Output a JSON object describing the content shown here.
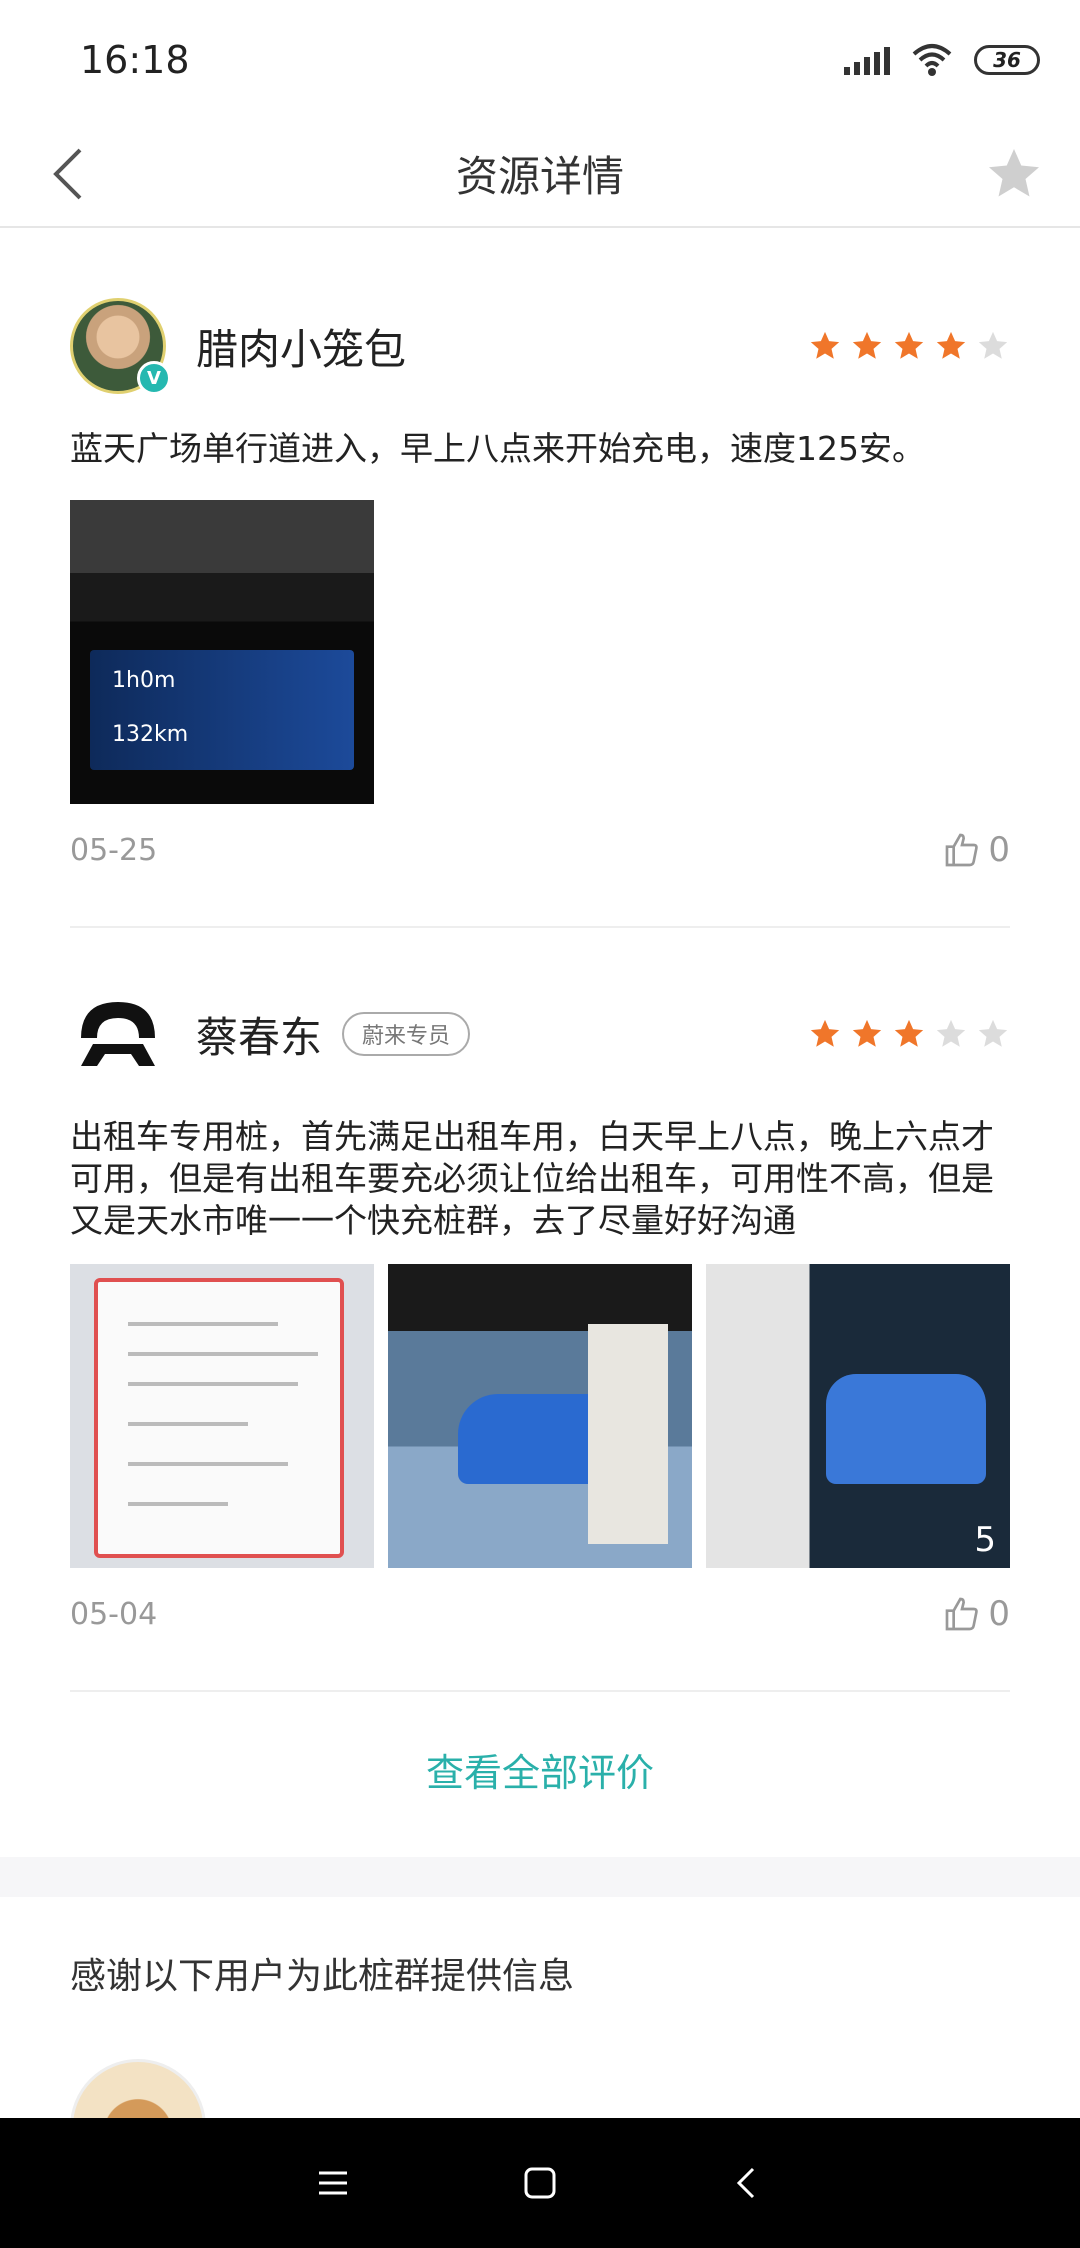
{
  "status_bar": {
    "time": "16:18",
    "battery": "36"
  },
  "header": {
    "title": "资源详情"
  },
  "reviews": [
    {
      "user": "腊肉小笼包",
      "verified_badge": "V",
      "rating": 4,
      "rating_max": 5,
      "text": "蓝天广场单行道进入，早上八点来开始充电，速度125安。",
      "photo_labels": [
        "1h0m",
        "132km"
      ],
      "date": "05-25",
      "likes": "0"
    },
    {
      "user": "蔡春东",
      "tag": "蔚来专员",
      "rating": 3,
      "rating_max": 5,
      "text": "出租车专用桩，首先满足出租车用，白天早上八点，晚上六点才可用，但是有出租车要充必须让位给出租车，可用性不高，但是又是天水市唯一一个快充桩群，去了尽量好好沟通",
      "photo_count": "5",
      "date": "05-04",
      "likes": "0"
    }
  ],
  "view_all_label": "查看全部评价",
  "contributors": {
    "title": "感谢以下用户为此桩群提供信息"
  },
  "colors": {
    "accent": "#2ab0aa",
    "star_active": "#f0762a",
    "star_inactive": "#dcdcdc"
  },
  "icons": [
    "back-icon",
    "star-icon",
    "thumb-up-icon",
    "menu-icon",
    "home-icon",
    "back-nav-icon"
  ]
}
